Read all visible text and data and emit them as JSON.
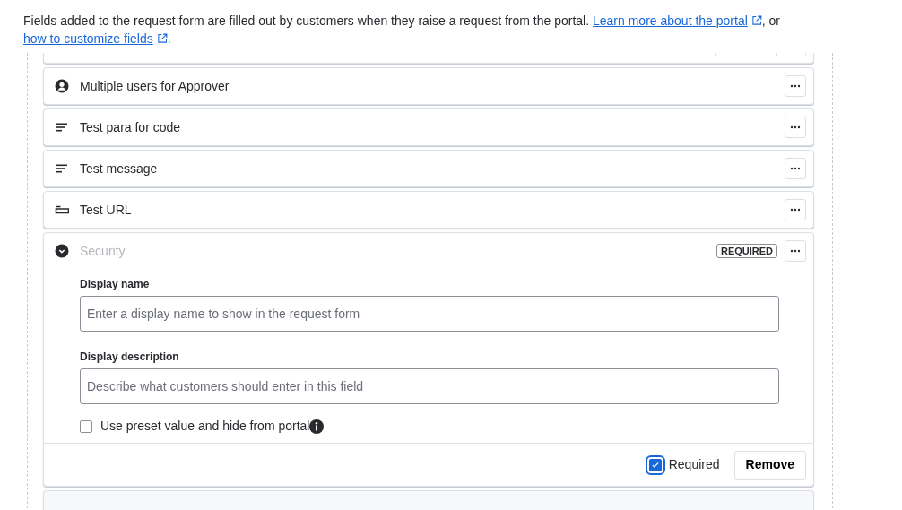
{
  "intro": [
    {
      "kind": "text",
      "text": "Fields added to the request form are filled out by customers when they raise a request from the portal. "
    },
    {
      "kind": "link",
      "text": "Learn more about the portal"
    },
    {
      "kind": "text",
      "text": ", or "
    },
    {
      "kind": "link",
      "text": "how to customize fields"
    },
    {
      "kind": "text",
      "text": "."
    }
  ],
  "fields": [
    {
      "kind": "person",
      "label": "Multiple users for Approver"
    },
    {
      "kind": "paragraph",
      "label": "Test para for code"
    },
    {
      "kind": "paragraph",
      "label": "Test message"
    },
    {
      "kind": "url",
      "label": "Test URL"
    },
    {
      "kind": "select",
      "label": "Security",
      "badge": "REQUIRED",
      "form": {
        "inputs": [
          {
            "label": "Display name",
            "placeholder": "Enter a display name to show in the request form"
          },
          {
            "label": "Display description",
            "placeholder": "Describe what customers should enter in this field"
          }
        ],
        "preset": {
          "label": "Use preset value and hide from portal",
          "checked": false
        },
        "required": {
          "label": "Required",
          "checked": true
        },
        "remove": "Remove"
      }
    }
  ]
}
